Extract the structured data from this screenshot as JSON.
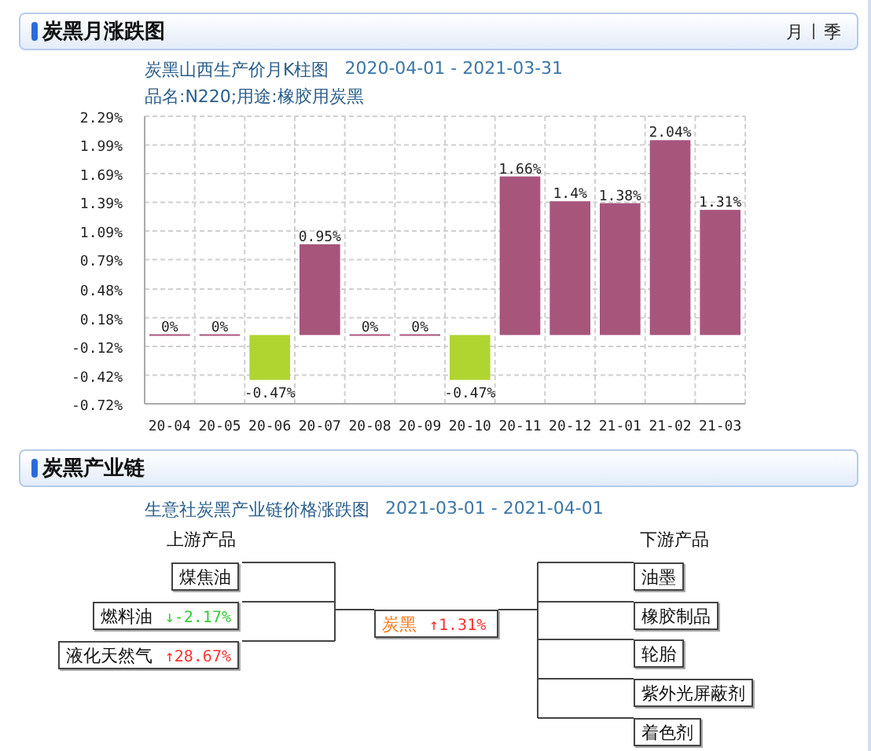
{
  "panel_top": {
    "title": "炭黑月涨跌图",
    "tabs": [
      {
        "label": "月"
      },
      {
        "label": "季"
      }
    ],
    "chart_heading": "炭黑山西生产价月K柱图",
    "date_range": "2020-04-01 - 2021-03-31",
    "subtitle": "品名:N220;用途:橡胶用炭黑",
    "chart_data": {
      "type": "bar",
      "categories": [
        "20-04",
        "20-05",
        "20-06",
        "20-07",
        "20-08",
        "20-09",
        "20-10",
        "20-11",
        "20-12",
        "21-01",
        "21-02",
        "21-03"
      ],
      "values": [
        0,
        0,
        -0.47,
        0.95,
        0,
        0,
        -0.47,
        1.66,
        1.4,
        1.38,
        2.04,
        1.31
      ],
      "value_labels": [
        "0%",
        "0%",
        "-0.47%",
        "0.95%",
        "0%",
        "0%",
        "-0.47%",
        "1.66%",
        "1.4%",
        "1.38%",
        "2.04%",
        "1.31%"
      ],
      "ylim": [
        -0.72,
        2.29
      ],
      "grid": true,
      "yticks": [
        {
          "value": 2.29,
          "label": "2.29%"
        },
        {
          "value": 1.99,
          "label": "1.99%"
        },
        {
          "value": 1.69,
          "label": "1.69%"
        },
        {
          "value": 1.39,
          "label": "1.39%"
        },
        {
          "value": 1.09,
          "label": "1.09%"
        },
        {
          "value": 0.79,
          "label": "0.79%"
        },
        {
          "value": 0.48,
          "label": "0.48%"
        },
        {
          "value": 0.18,
          "label": "0.18%"
        },
        {
          "value": -0.12,
          "label": "-0.12%"
        },
        {
          "value": -0.42,
          "label": "-0.42%"
        },
        {
          "value": -0.72,
          "label": "-0.72%"
        }
      ]
    }
  },
  "panel_chain": {
    "title": "炭黑产业链",
    "chart_heading": "生意社炭黑产业链价格涨跌图",
    "date_range": "2021-03-01 - 2021-04-01",
    "upstream_label": "上游产品",
    "downstream_label": "下游产品",
    "upstream": [
      {
        "name": "煤焦油"
      },
      {
        "name": "燃料油",
        "color": "#33cc33",
        "arrow": "↓",
        "change": "-2.17%"
      },
      {
        "name": "液化天然气",
        "color": "#ff3333",
        "arrow": "↑",
        "change": "28.67%"
      }
    ],
    "center": {
      "name": "炭黑",
      "color": "#ff3333",
      "arrow": "↑",
      "change": "1.31%"
    },
    "downstream": [
      {
        "name": "油墨"
      },
      {
        "name": "橡胶制品"
      },
      {
        "name": "轮胎"
      },
      {
        "name": "紫外光屏蔽剂"
      },
      {
        "name": "着色剂"
      }
    ]
  }
}
